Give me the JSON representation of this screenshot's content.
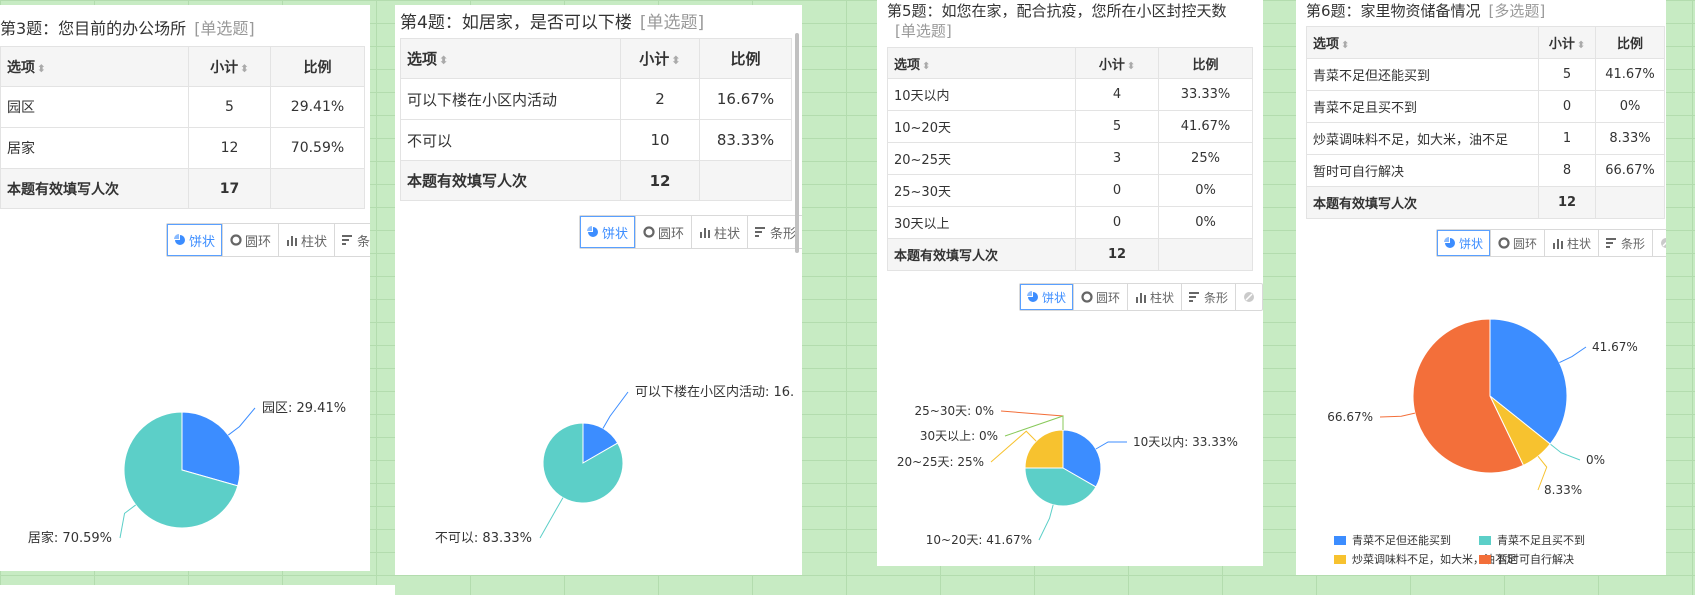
{
  "questions": [
    {
      "title": "第3题：您目前的办公场所",
      "type": "[单选题]",
      "table": {
        "headers": {
          "option": "选项",
          "count": "小计",
          "percent": "比例"
        },
        "rows": [
          {
            "option": "园区",
            "count": "5",
            "percent": "29.41%"
          },
          {
            "option": "居家",
            "count": "12",
            "percent": "70.59%"
          }
        ],
        "total": {
          "label": "本题有效填写人次",
          "count": "17"
        }
      },
      "buttons": [
        "饼状",
        "圆环",
        "柱状",
        "条形"
      ],
      "active_button": "饼状",
      "chart_data": {
        "type": "pie",
        "categories": [
          "园区",
          "居家"
        ],
        "values": [
          29.41,
          70.59
        ],
        "labels": [
          "园区: 29.41%",
          "居家: 70.59%"
        ],
        "colors": [
          "#3c8dff",
          "#5ccfc8"
        ]
      }
    },
    {
      "title": "第4题：如居家，是否可以下楼",
      "type": "[单选题]",
      "table": {
        "headers": {
          "option": "选项",
          "count": "小计",
          "percent": "比例"
        },
        "rows": [
          {
            "option": "可以下楼在小区内活动",
            "count": "2",
            "percent": "16.67%"
          },
          {
            "option": "不可以",
            "count": "10",
            "percent": "83.33%"
          }
        ],
        "total": {
          "label": "本题有效填写人次",
          "count": "12"
        }
      },
      "buttons": [
        "饼状",
        "圆环",
        "柱状",
        "条形"
      ],
      "active_button": "饼状",
      "chart_data": {
        "type": "pie",
        "categories": [
          "可以下楼在小区内活动",
          "不可以"
        ],
        "values": [
          16.67,
          83.33
        ],
        "labels": [
          "可以下楼在小区内活动: 16.",
          "不可以: 83.33%"
        ],
        "colors": [
          "#3c8dff",
          "#5ccfc8"
        ]
      }
    },
    {
      "title": "第5题：如您在家，配合抗疫，您所在小区封控天数",
      "type": "[单选题]",
      "table": {
        "headers": {
          "option": "选项",
          "count": "小计",
          "percent": "比例"
        },
        "rows": [
          {
            "option": "10天以内",
            "count": "4",
            "percent": "33.33%"
          },
          {
            "option": "10~20天",
            "count": "5",
            "percent": "41.67%"
          },
          {
            "option": "20~25天",
            "count": "3",
            "percent": "25%"
          },
          {
            "option": "25~30天",
            "count": "0",
            "percent": "0%"
          },
          {
            "option": "30天以上",
            "count": "0",
            "percent": "0%"
          }
        ],
        "total": {
          "label": "本题有效填写人次",
          "count": "12"
        }
      },
      "buttons": [
        "饼状",
        "圆环",
        "柱状",
        "条形"
      ],
      "active_button": "饼状",
      "chart_data": {
        "type": "pie",
        "categories": [
          "10天以内",
          "10~20天",
          "20~25天",
          "25~30天",
          "30天以上"
        ],
        "values": [
          33.33,
          41.67,
          25,
          0,
          0
        ],
        "labels": [
          "10天以内: 33.33%",
          "10~20天: 41.67%",
          "20~25天: 25%",
          "25~30天: 0%",
          "30天以上: 0%"
        ],
        "colors": [
          "#3c8dff",
          "#5ccfc8",
          "#f7c22f",
          "#f36f3a",
          "#88c95a"
        ]
      }
    },
    {
      "title": "第6题：家里物资储备情况",
      "type": "[多选题]",
      "table": {
        "headers": {
          "option": "选项",
          "count": "小计",
          "percent": "比例"
        },
        "rows": [
          {
            "option": "青菜不足但还能买到",
            "count": "5",
            "percent": "41.67%"
          },
          {
            "option": "青菜不足且买不到",
            "count": "0",
            "percent": "0%"
          },
          {
            "option": "炒菜调味料不足，如大米，油不足",
            "count": "1",
            "percent": "8.33%"
          },
          {
            "option": "暂时可自行解决",
            "count": "8",
            "percent": "66.67%"
          }
        ],
        "total": {
          "label": "本题有效填写人次",
          "count": "12"
        }
      },
      "buttons": [
        "饼状",
        "圆环",
        "柱状",
        "条形"
      ],
      "active_button": "饼状",
      "chart_data": {
        "type": "pie",
        "categories": [
          "青菜不足但还能买到",
          "青菜不足且买不到",
          "炒菜调味料不足，如大米，油不足",
          "暂时可自行解决"
        ],
        "values": [
          41.67,
          0,
          8.33,
          66.67
        ],
        "labels": [
          "41.67%",
          "0%",
          "8.33%",
          "66.67%"
        ],
        "colors": [
          "#3c8dff",
          "#5ccfc8",
          "#f7c22f",
          "#f36f3a"
        ],
        "legend": [
          "青菜不足但还能买到",
          "青菜不足且买不到",
          "炒菜调味料不足，如大米，油不足",
          "暂时可自行解决"
        ]
      }
    }
  ]
}
